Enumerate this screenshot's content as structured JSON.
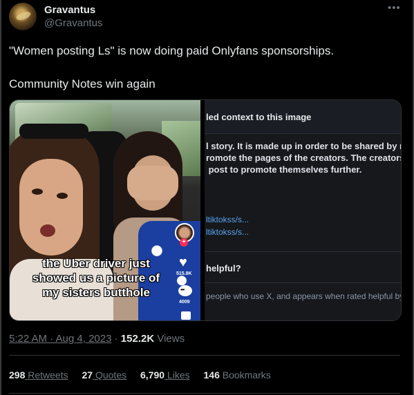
{
  "tweet": {
    "author_name": "Gravantus",
    "author_handle": "@Gravantus",
    "more_icon": "•••",
    "text_line1": "\"Women posting Ls\" is now doing paid Onlyfans sponsorships.",
    "text_line2": "Community Notes win again",
    "timestamp": "5:22 AM · Aug 4, 2023",
    "views_sep": " · ",
    "views_count": "152.2K",
    "views_label": "Views"
  },
  "media": {
    "video": {
      "caption_lines": [
        "the Uber driver just",
        "showed us a picture of",
        "my sisters butthole"
      ],
      "likes": "515.8K",
      "comments": "4009",
      "plus": "+",
      "heart_icon": "♥"
    },
    "note": {
      "title": "led context to this image",
      "body": "l story. It is made up in order to be shared by m\nromote the pages of the creators. The creators \n post to promote themselves further.",
      "link1": "ltiktokss/s...",
      "link2": "ltiktokss/s...",
      "helpful": "helpful?",
      "footer": "people who use X, and appears when rated helpful by"
    }
  },
  "stats": {
    "retweets_count": "298",
    "retweets_label": " Retweets",
    "quotes_count": "27",
    "quotes_label": " Quotes",
    "likes_count": "6,790",
    "likes_label": " Likes",
    "bookmarks_count": "146",
    "bookmarks_label": " Bookmarks"
  },
  "colors": {
    "background": "#000000",
    "text_primary": "#e7e9ea",
    "text_secondary": "#71767b",
    "link": "#5ba4f1"
  }
}
